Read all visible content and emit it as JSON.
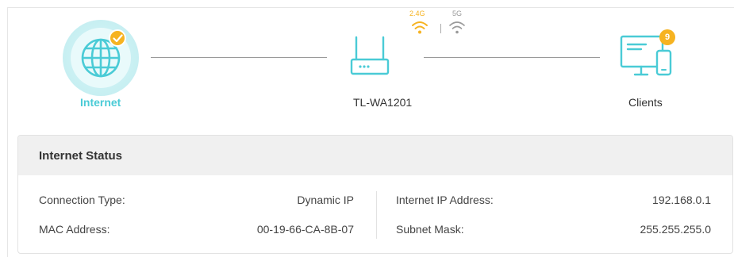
{
  "topology": {
    "internet": {
      "label": "Internet",
      "status_icon": "check-icon"
    },
    "device": {
      "label": "TL-WA1201"
    },
    "bands": {
      "band_24_label": "2.4G",
      "band_5_label": "5G",
      "active_color": "#f6b321",
      "inactive_color": "#999999"
    },
    "clients": {
      "label": "Clients",
      "count": "9"
    }
  },
  "internet_status": {
    "title": "Internet Status",
    "rows": [
      {
        "label": "Connection Type:",
        "value": "Dynamic IP"
      },
      {
        "label": "MAC Address:",
        "value": "00-19-66-CA-8B-07"
      },
      {
        "label": "Internet IP Address:",
        "value": "192.168.0.1"
      },
      {
        "label": "Subnet Mask:",
        "value": "255.255.255.0"
      }
    ]
  },
  "colors": {
    "accent": "#4acbd6",
    "badge": "#f6b321"
  }
}
